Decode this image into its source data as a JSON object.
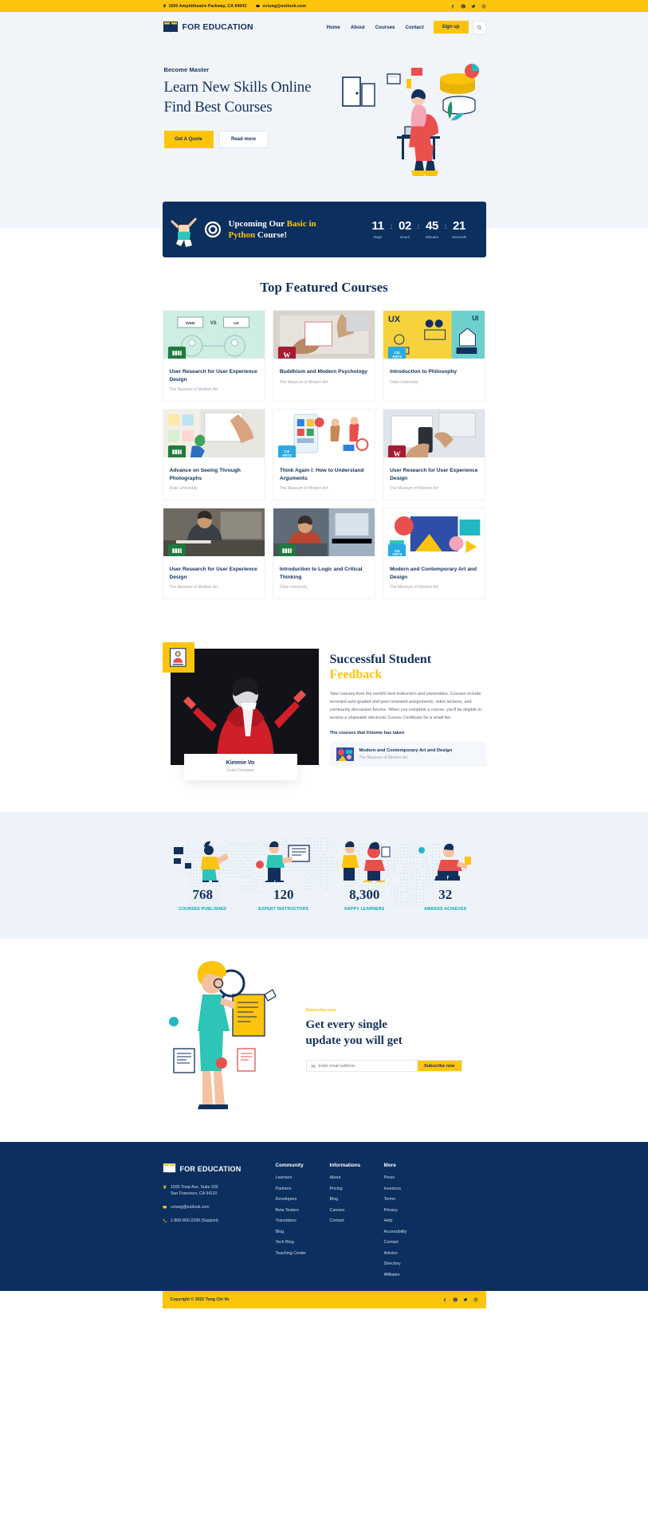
{
  "colors": {
    "yellow": "#fcc40d",
    "navy": "#0b2f5e",
    "navy_text": "#12305c",
    "teal": "#00a3b4",
    "light_bg": "#f1f5f9",
    "stats_bg": "#eef3f9"
  },
  "topbar": {
    "address": "1600 Amphitheatre Parkway, CA 94043",
    "email": "vctung@outlook.com",
    "address_icon": "location-pin-icon",
    "email_icon": "envelope-icon",
    "socials": [
      "facebook-icon",
      "pinterest-icon",
      "twitter-icon",
      "instagram-icon"
    ]
  },
  "header": {
    "brand": "FOR EDUCATION",
    "brand_icon": "open-book-icon",
    "nav": [
      "Home",
      "About",
      "Courses",
      "Contact"
    ],
    "signup_label": "Sign up",
    "search_icon": "search-icon"
  },
  "hero": {
    "kicker": "Become Master",
    "title_line1": "Learn New Skills Online",
    "title_line2": "Find Best Courses",
    "primary_button": "Get A Quote",
    "secondary_button": "Read more"
  },
  "countdown": {
    "title_part1": "Upcoming Our ",
    "title_highlight1": "Basic in",
    "title_highlight2": "Python",
    "title_part2": " Course!",
    "mascot_icon": "celebrating-person-icon",
    "target_icon": "target-icon",
    "units": [
      {
        "value": "11",
        "label": "Days"
      },
      {
        "value": "02",
        "label": "Hours"
      },
      {
        "value": "45",
        "label": "Minutes"
      },
      {
        "value": "21",
        "label": "Seconds"
      }
    ],
    "separator": ":"
  },
  "featured": {
    "title": "Top Featured Courses",
    "courses": [
      {
        "title": "User Research for User Experience Design",
        "provider": "The Museum of Modern Art",
        "badge": "alberta",
        "badge_color": "#1f7a3d",
        "thumb": "web-vs-ux-designer-diagram",
        "thumb_bg": "#cdeee0"
      },
      {
        "title": "Buddhism and Modern Psychology",
        "provider": "The Museum of Modern Art",
        "badge": "W",
        "badge_color": "#a51c30",
        "thumb": "hands-wireframe-sketch-photo",
        "thumb_bg": "#d8d3cb"
      },
      {
        "title": "Introduction to Philosophy",
        "provider": "Duke University",
        "badge": "CalARTS",
        "badge_color": "#29abe2",
        "thumb": "ux-illustration-yellow-teal",
        "thumb_bg": "#f6d33c"
      },
      {
        "title": "Advance on Seeing Through Photographs",
        "provider": "Duke University",
        "badge": "alberta",
        "badge_color": "#1f7a3d",
        "thumb": "desk-notes-writing-photo",
        "thumb_bg": "#e8e6e0"
      },
      {
        "title": "Think Again I: How to Understand Arguments",
        "provider": "The Museum of Modern Art",
        "badge": "CalARTS",
        "badge_color": "#29abe2",
        "thumb": "mobile-app-people-illustration",
        "thumb_bg": "#ffffff"
      },
      {
        "title": "User Research for User Experience Design",
        "provider": "The Museum of Modern Art",
        "badge": "W",
        "badge_color": "#a51c30",
        "thumb": "hand-holding-phone-photo",
        "thumb_bg": "#cfd6dd"
      },
      {
        "title": "User Research for User Experience Design",
        "provider": "The Museum of Modern Art",
        "badge": "alberta",
        "badge_color": "#1f7a3d",
        "thumb": "man-writing-at-desk-photo",
        "thumb_bg": "#7e7a72"
      },
      {
        "title": "Introduction to Logic and Critical Thinking",
        "provider": "Duke University",
        "badge": "alberta",
        "badge_color": "#1f7a3d",
        "thumb": "man-at-computer-photo",
        "thumb_bg": "#6f7a84"
      },
      {
        "title": "Modern and Contemporary Art and Design",
        "provider": "The Museum of Modern Art",
        "badge": "CalARTS",
        "badge_color": "#29abe2",
        "thumb": "colorful-art-design-illustration",
        "thumb_bg": "#2e4fa8"
      }
    ]
  },
  "testimonial": {
    "heading_line1": "Successful Student",
    "heading_line2": "Feedback",
    "paragraph": "Take courses from the world's best instructors and universities. Courses include recorded auto-graded and peer-reviewed assignments, video lectures, and community discussion forums. When you complete a course, you'll be eligible to receive a shareable electronic Course Certificate for a small fee.",
    "subheading": "The courses that Kimmie has taken",
    "student_name": "Kimmie Vo",
    "student_role": "Junior Designer",
    "photo": "graduate-in-red-gown-photo",
    "course": {
      "title": "Modern and Contemporary Art and Design",
      "provider": "The Museum of Modern Art",
      "thumb": "colorful-art-design-illustration"
    }
  },
  "stats": {
    "items": [
      {
        "value": "768",
        "label": "COURSES PUBLISHED",
        "art": "person-with-devices-illustration"
      },
      {
        "value": "120",
        "label": "EXPERT INSTRUCTORS",
        "art": "instructor-presenting-illustration"
      },
      {
        "value": "8,300",
        "label": "HAPPY LEARNERS",
        "art": "learners-group-illustration"
      },
      {
        "value": "32",
        "label": "AWARDS ACHIEVED",
        "art": "person-reading-illustration"
      }
    ],
    "background_art": "world-dot-map"
  },
  "newsletter": {
    "kicker": "Subscribe now",
    "heading_line1": "Get every single",
    "heading_line2": "update you will get",
    "placeholder": "Enter email address",
    "input_value": "",
    "button_label": "Subscribe now",
    "art": "woman-with-magnifier-and-documents-illustration",
    "input_icon": "envelope-icon"
  },
  "footer": {
    "brand": "FOR EDUCATION",
    "brand_icon": "open-book-icon",
    "address": "1500 Treat Ave, Suite 200\nSan Francisco, CA 94110",
    "address_line1": "1500 Treat Ave, Suite 200",
    "address_line2": "San Francisco, CA 94110",
    "email": "vctung@outlook.com",
    "phone": "1-800-800-2299 (Support)",
    "location_icon": "location-pin-icon",
    "email_icon": "envelope-icon",
    "phone_icon": "phone-icon",
    "columns": [
      {
        "title": "Community",
        "links": [
          "Learners",
          "Partners",
          "Developers",
          "Beta Testers",
          "Translators",
          "Blog",
          "Tech Blog",
          "Teaching Center"
        ]
      },
      {
        "title": "Informations",
        "links": [
          "About",
          "Pricing",
          "Blog",
          "Careers",
          "Contact"
        ]
      },
      {
        "title": "More",
        "links": [
          "Press",
          "Investors",
          "Terms",
          "Privacy",
          "Help",
          "Accessibility",
          "Contact",
          "Articles",
          "Directory",
          "Affiliates"
        ]
      }
    ],
    "copyright": "Copyright © 2021 Tung Chi Vo",
    "socials": [
      "facebook-icon",
      "pinterest-icon",
      "twitter-icon",
      "instagram-icon"
    ]
  }
}
